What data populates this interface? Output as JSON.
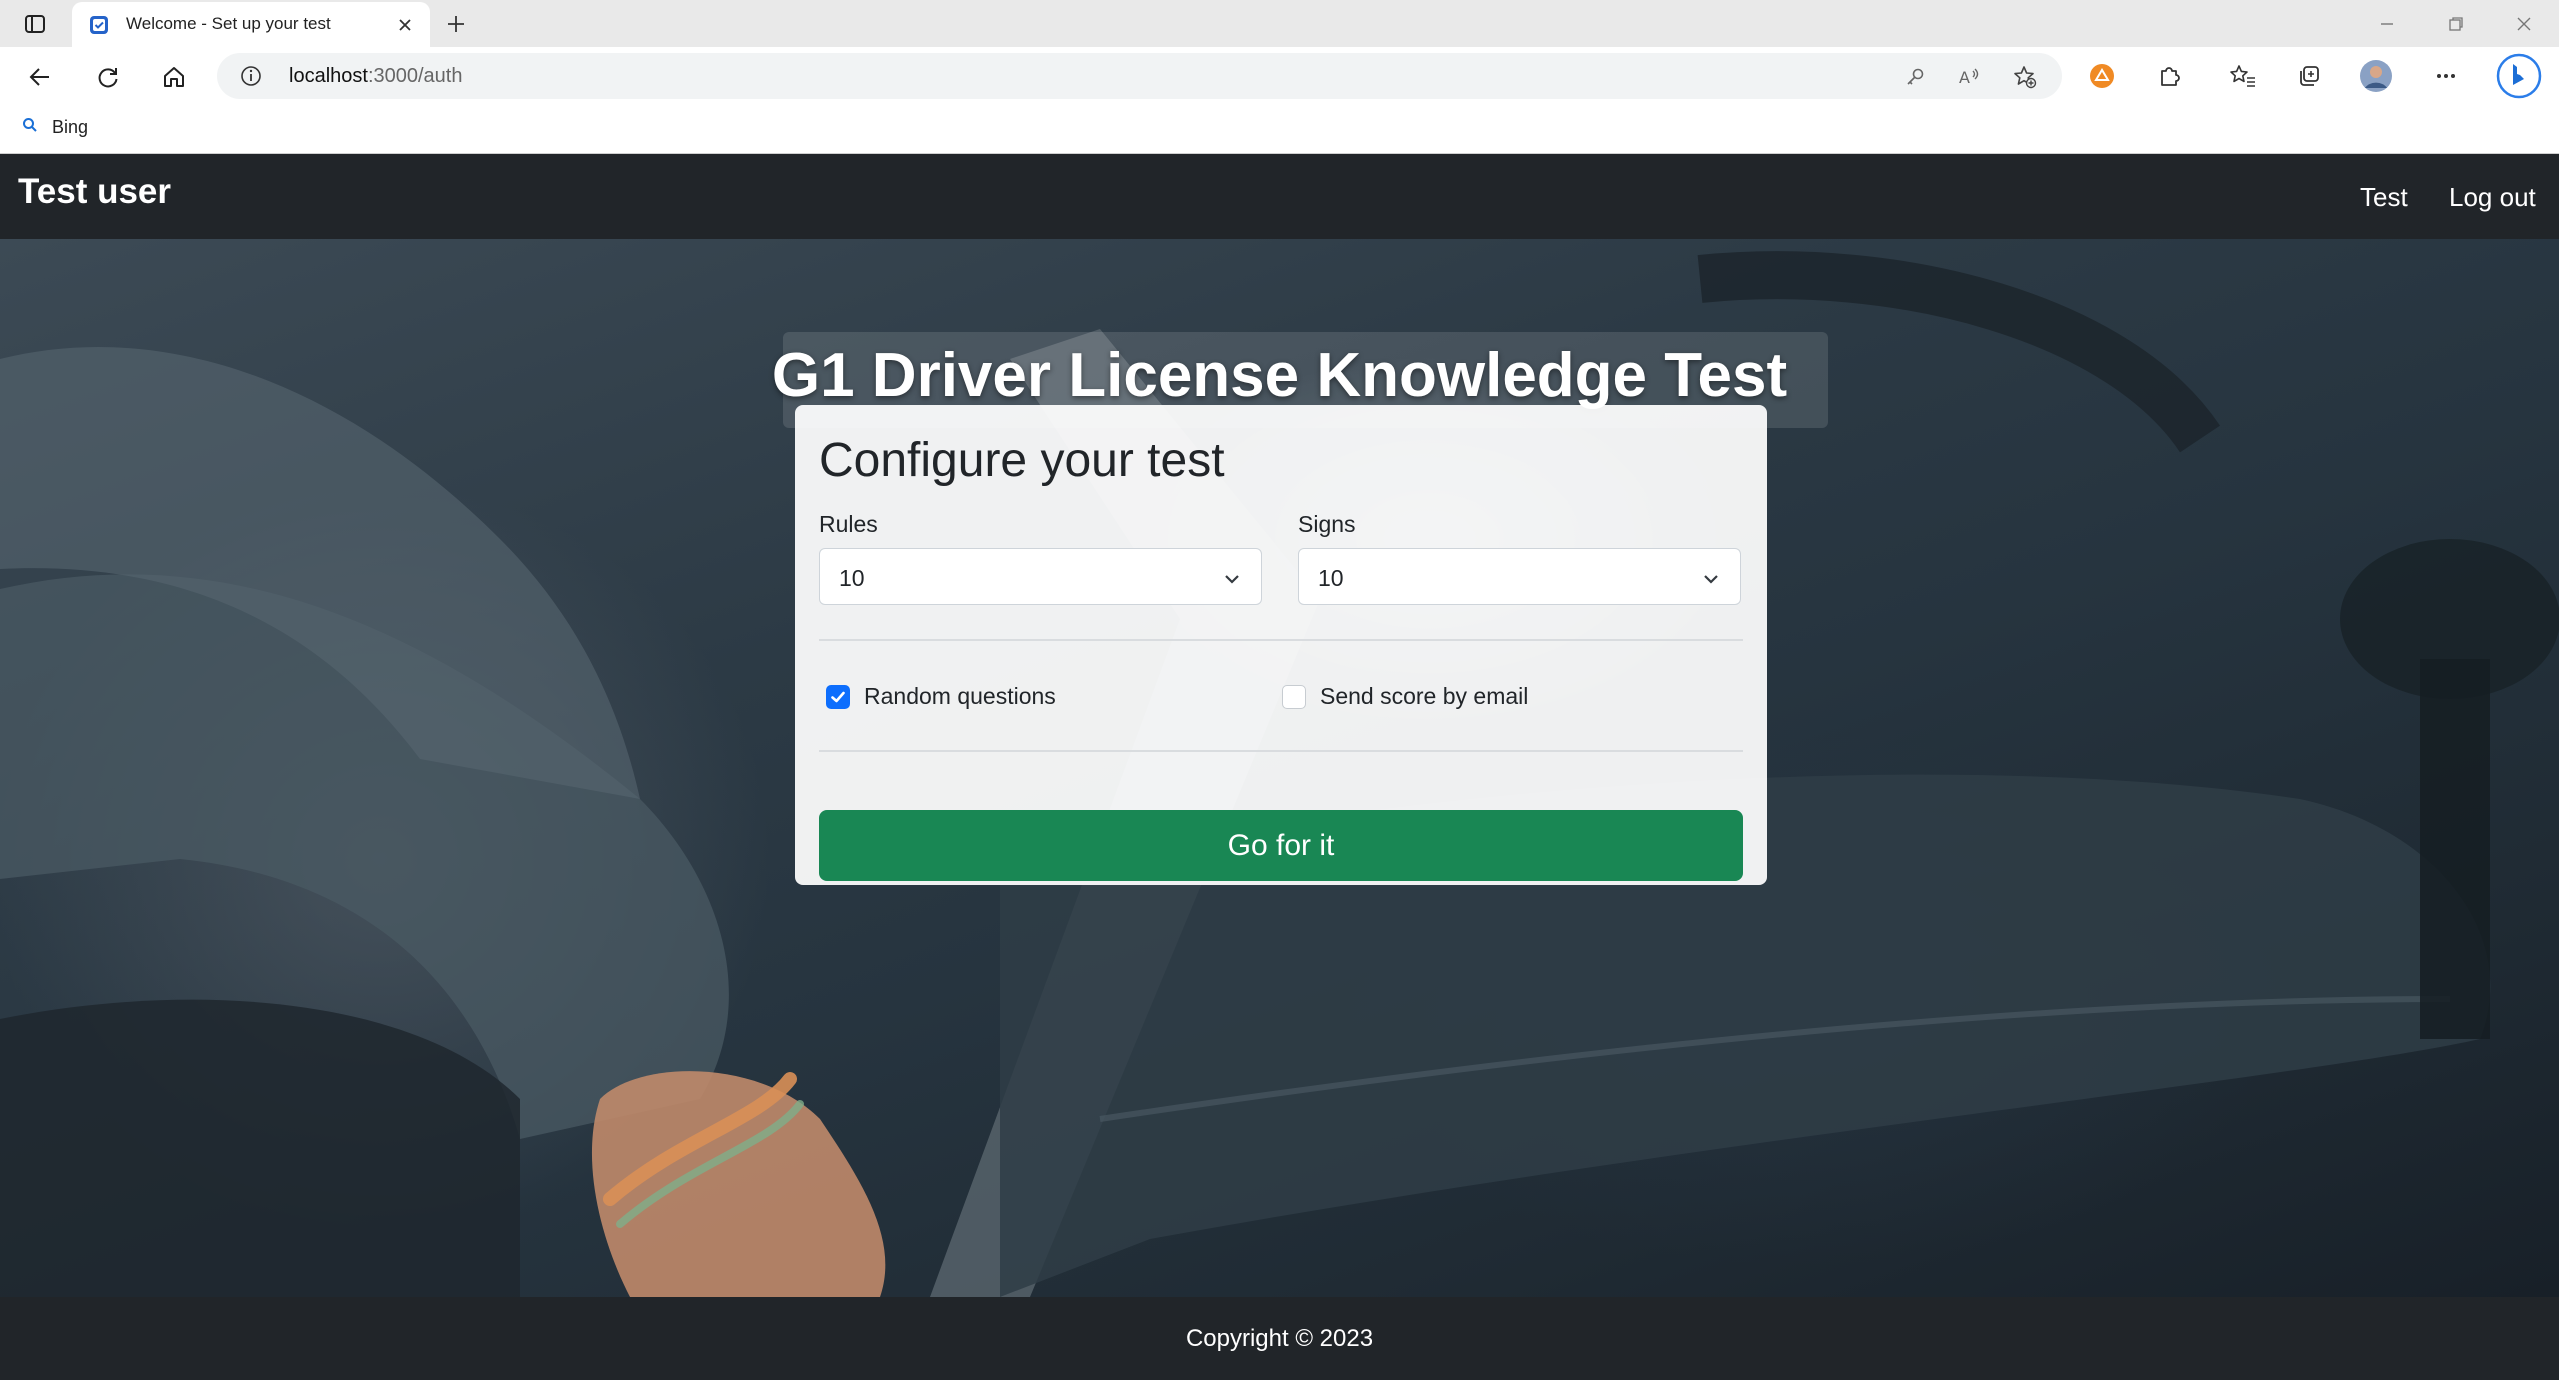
{
  "browser": {
    "tab": {
      "title": "Welcome - Set up your test",
      "favicon": "checkbox-favicon-icon"
    },
    "address": {
      "host": "localhost",
      "path": ":3000/auth"
    },
    "favorites": [
      {
        "label": "Bing",
        "icon": "search-icon"
      }
    ],
    "colors": {
      "tabbar": "#e9e9e9",
      "toolbar": "#ffffff"
    }
  },
  "navbar": {
    "brand": "Test user",
    "links": [
      {
        "label": "Test"
      },
      {
        "label": "Log out"
      }
    ]
  },
  "hero": {
    "title": "G1 Driver License Knowledge Test"
  },
  "config": {
    "heading": "Configure your test",
    "rules": {
      "label": "Rules",
      "value": "10"
    },
    "signs": {
      "label": "Signs",
      "value": "10"
    },
    "random_questions": {
      "label": "Random questions",
      "checked": true
    },
    "send_score": {
      "label": "Send score by email",
      "checked": false
    },
    "submit_label": "Go for it"
  },
  "footer": {
    "copyright": "Copyright © 2023"
  },
  "colors": {
    "navbar": "#212529",
    "button": "#198754",
    "checkbox": "#0d6efd"
  }
}
